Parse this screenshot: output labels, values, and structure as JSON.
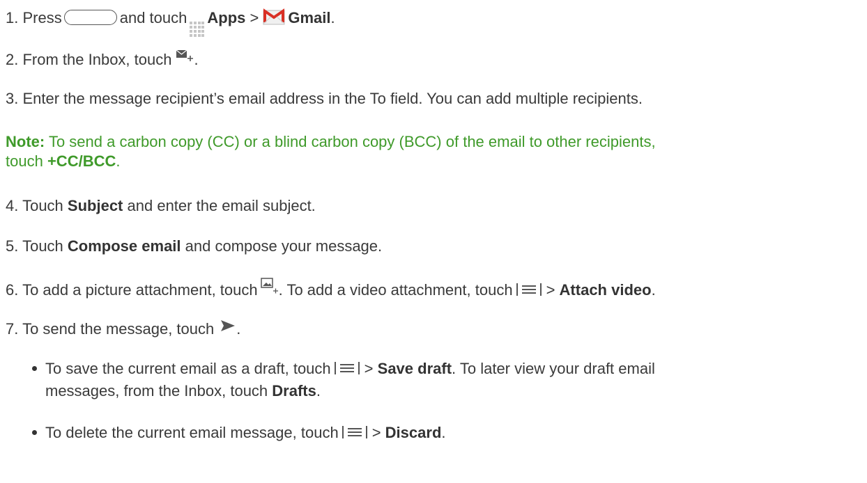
{
  "steps": {
    "s1": {
      "num": "1.",
      "t1": "Press",
      "t2": "and touch",
      "apps": "Apps",
      "sep": ">",
      "gmail": "Gmail",
      "end": "."
    },
    "s2": {
      "num": "2.",
      "t1": "From the Inbox, touch",
      "end": "."
    },
    "s3": {
      "num": "3.",
      "t1": "Enter the message recipient’s email address in the To field. You can add multiple recipients."
    },
    "s4": {
      "num": "4.",
      "t1": "Touch",
      "b1": "Subject",
      "t2": "and enter the email subject."
    },
    "s5": {
      "num": "5.",
      "t1": "Touch",
      "b1": "Compose email",
      "t2": "and compose your message."
    },
    "s6": {
      "num": "6.",
      "t1": "To add a picture attachment, touch",
      "t2": ". To add a video attachment, touch",
      "sep": ">",
      "b1": "Attach video",
      "end": "."
    },
    "s7": {
      "num": "7.",
      "t1": "To send the message, touch",
      "end": "."
    }
  },
  "note": {
    "label": "Note:",
    "line1": "To send a carbon copy (CC) or a blind carbon copy (BCC) of the email to other recipients,",
    "t1": "touch",
    "b1": "+CC/BCC",
    "end": "."
  },
  "bullets": {
    "b1": {
      "t1": "To save the current email as a draft, touch",
      "sep": ">",
      "bold1": "Save draft",
      "t2": ". To later view your draft email",
      "line2a": "messages, from the Inbox, touch",
      "bold2": "Drafts",
      "end": "."
    },
    "b2": {
      "t1": "To delete the current email message, touch",
      "sep": ">",
      "bold1": "Discard",
      "end": "."
    }
  },
  "icons": {
    "home": "home-key-icon",
    "apps": "apps-grid-icon",
    "gmail": "gmail-icon",
    "compose": "compose-icon",
    "picture": "picture-attach-icon",
    "menu": "menu-icon",
    "send": "send-icon"
  },
  "colors": {
    "note": "#3f9a2a",
    "gmail_red": "#d93025"
  }
}
